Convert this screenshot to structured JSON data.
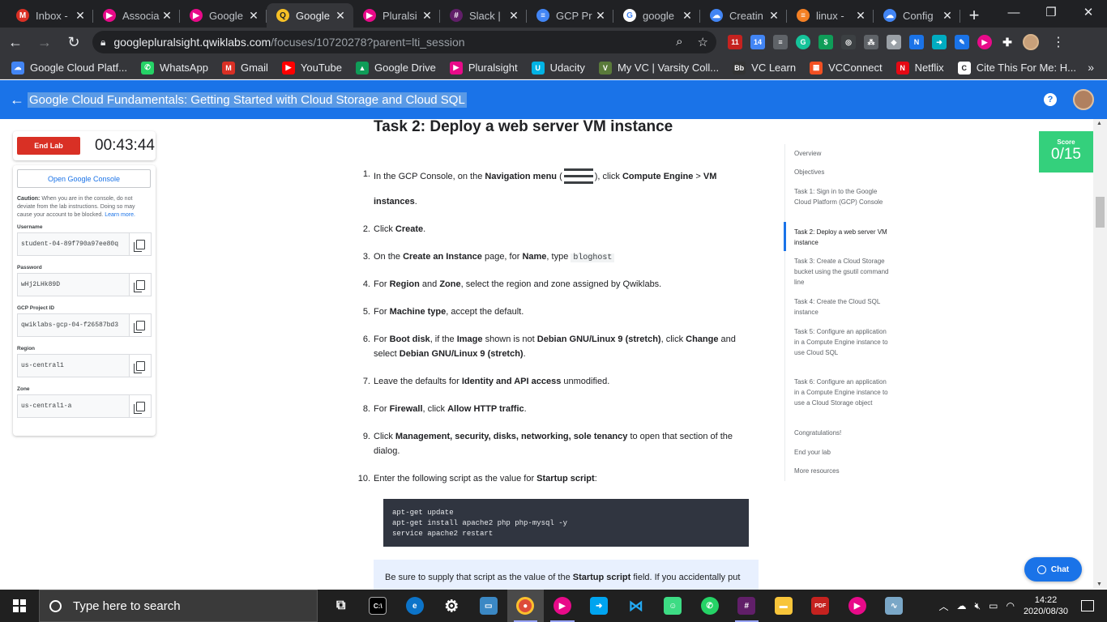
{
  "browser": {
    "tabs": [
      {
        "label": "Inbox - ",
        "icon": "gmail-icon",
        "color": "#d93025",
        "glyph": "M"
      },
      {
        "label": "Associa",
        "icon": "pluralsight-icon",
        "color": "#e80a89",
        "glyph": "▶"
      },
      {
        "label": "Google",
        "icon": "pluralsight-icon",
        "color": "#e80a89",
        "glyph": "▶"
      },
      {
        "label": "Google",
        "icon": "qwiklabs-icon",
        "color": "#f6c026",
        "glyph": "Q",
        "active": true
      },
      {
        "label": "Pluralsi",
        "icon": "pluralsight-icon",
        "color": "#e80a89",
        "glyph": "▶"
      },
      {
        "label": "Slack |",
        "icon": "slack-icon",
        "color": "#611f69",
        "glyph": "#"
      },
      {
        "label": "GCP Pr",
        "icon": "docs-icon",
        "color": "#4285f4",
        "glyph": "≡"
      },
      {
        "label": "google",
        "icon": "google-icon",
        "color": "#ffffff",
        "glyph": "G"
      },
      {
        "label": "Creatin",
        "icon": "cloud-icon",
        "color": "#4285f4",
        "glyph": "☁"
      },
      {
        "label": "linux - ",
        "icon": "stackoverflow-icon",
        "color": "#f48024",
        "glyph": "≡"
      },
      {
        "label": "Config",
        "icon": "cloud-icon",
        "color": "#4285f4",
        "glyph": "☁"
      }
    ],
    "url_host": "googlepluralsight.qwiklabs.com",
    "url_path": "/focuses/10720278?parent=lti_session",
    "bookmarks": [
      {
        "label": "Google Cloud Platf...",
        "icon": "cloud-icon",
        "color": "#4285f4",
        "glyph": "☁"
      },
      {
        "label": "WhatsApp",
        "icon": "whatsapp-icon",
        "color": "#25d366",
        "glyph": "✆"
      },
      {
        "label": "Gmail",
        "icon": "gmail-icon",
        "color": "#d93025",
        "glyph": "M"
      },
      {
        "label": "YouTube",
        "icon": "youtube-icon",
        "color": "#ff0000",
        "glyph": "▶"
      },
      {
        "label": "Google Drive",
        "icon": "drive-icon",
        "color": "#0f9d58",
        "glyph": "▲"
      },
      {
        "label": "Pluralsight",
        "icon": "pluralsight-icon",
        "color": "#e80a89",
        "glyph": "▶"
      },
      {
        "label": "Udacity",
        "icon": "udacity-icon",
        "color": "#02b3e4",
        "glyph": "U"
      },
      {
        "label": "My VC | Varsity Coll...",
        "icon": "varsity-icon",
        "color": "#5a7a3a",
        "glyph": "V"
      },
      {
        "label": "VC Learn",
        "icon": "blackboard-icon",
        "color": "#333333",
        "glyph": "Bb"
      },
      {
        "label": "VCConnect",
        "icon": "microsoft-icon",
        "color": "#f25022",
        "glyph": "▦"
      },
      {
        "label": "Netflix",
        "icon": "netflix-icon",
        "color": "#e50914",
        "glyph": "N"
      },
      {
        "label": "Cite This For Me: H...",
        "icon": "citethis-icon",
        "color": "#ffffff",
        "glyph": "C"
      }
    ]
  },
  "app": {
    "title": "Google Cloud Fundamentals: Getting Started with Cloud Storage and Cloud SQL",
    "help": "?"
  },
  "lab": {
    "end_button": "End Lab",
    "timer": "00:43:44",
    "open_console": "Open Google Console",
    "caution_bold": "Caution:",
    "caution_text": " When you are in the console, do not deviate from the lab instructions. Doing so may cause your account to be blocked.",
    "learn_more": "Learn more.",
    "fields": [
      {
        "label": "Username",
        "value": "student-04-89f790a97ee80q"
      },
      {
        "label": "Password",
        "value": "wHj2LHk89D"
      },
      {
        "label": "GCP Project ID",
        "value": "qwiklabs-gcp-04-f26587bd3"
      },
      {
        "label": "Region",
        "value": "us-central1"
      },
      {
        "label": "Zone",
        "value": "us-central1-a"
      }
    ]
  },
  "task": {
    "heading": "Task 2: Deploy a web server VM instance",
    "steps": {
      "s1": {
        "num": "1.",
        "a": "In the GCP Console, on the ",
        "b": "Navigation menu",
        "c": " (",
        "d": "), click ",
        "e": "Compute Engine",
        "f": " > ",
        "g": "VM",
        "h": "instances",
        "i": "."
      },
      "s2": {
        "num": "2.",
        "a": "Click ",
        "b": "Create",
        "c": "."
      },
      "s3": {
        "num": "3.",
        "a": "On the ",
        "b": "Create an Instance",
        "c": " page, for ",
        "d": "Name",
        "e": ", type ",
        "f": "bloghost"
      },
      "s4": {
        "num": "4.",
        "a": "For ",
        "b": "Region",
        "c": " and ",
        "d": "Zone",
        "e": ", select the region and zone assigned by Qwiklabs."
      },
      "s5": {
        "num": "5.",
        "a": "For ",
        "b": "Machine type",
        "c": ", accept the default."
      },
      "s6": {
        "num": "6.",
        "a": "For ",
        "b": "Boot disk",
        "c": ", if the ",
        "d": "Image",
        "e": " shown is not ",
        "f": "Debian GNU/Linux 9 (stretch)",
        "g": ", click ",
        "h": "Change",
        "i": " and",
        "j": "select ",
        "k": "Debian GNU/Linux 9 (stretch)",
        "l": "."
      },
      "s7": {
        "num": "7.",
        "a": "Leave the defaults for ",
        "b": "Identity and API access",
        "c": " unmodified."
      },
      "s8": {
        "num": "8.",
        "a": "For ",
        "b": "Firewall",
        "c": ", click ",
        "d": "Allow HTTP traffic",
        "e": "."
      },
      "s9": {
        "num": "9.",
        "a": "Click ",
        "b": "Management, security, disks, networking, sole tenancy",
        "c": " to open that section of the",
        "d": "dialog."
      },
      "s10": {
        "num": "10.",
        "a": "Enter the following script as the value for ",
        "b": "Startup script",
        "c": ":"
      }
    },
    "code": "apt-get update\napt-get install apache2 php php-mysql -y\nservice apache2 restart",
    "note_a": "Be sure to supply that script as the value of the ",
    "note_b": "Startup script",
    "note_c": " field. If you accidentally put"
  },
  "toc": [
    {
      "label": "Overview"
    },
    {
      "label": "Objectives"
    },
    {
      "label": "Task 1: Sign in to the Google Cloud Platform (GCP) Console"
    },
    {
      "label": "Task 2: Deploy a web server VM instance",
      "active": true
    },
    {
      "label": "Task 3: Create a Cloud Storage bucket using the gsutil command line"
    },
    {
      "label": "Task 4: Create the Cloud SQL instance"
    },
    {
      "label": "Task 5: Configure an application in a Compute Engine instance to use Cloud SQL"
    },
    {
      "label": "Task 6: Configure an application in a Compute Engine instance to use a Cloud Storage object"
    },
    {
      "label": "Congratulations!"
    },
    {
      "label": "End your lab"
    },
    {
      "label": "More resources"
    }
  ],
  "score": {
    "label": "Score",
    "value": "0/15"
  },
  "chat": {
    "label": "Chat"
  },
  "taskbar": {
    "search_placeholder": "Type here to search",
    "time": "14:22",
    "date": "2020/08/30"
  },
  "colors": {
    "accent": "#1a73e8",
    "score": "#34d07c",
    "danger": "#d93025"
  }
}
